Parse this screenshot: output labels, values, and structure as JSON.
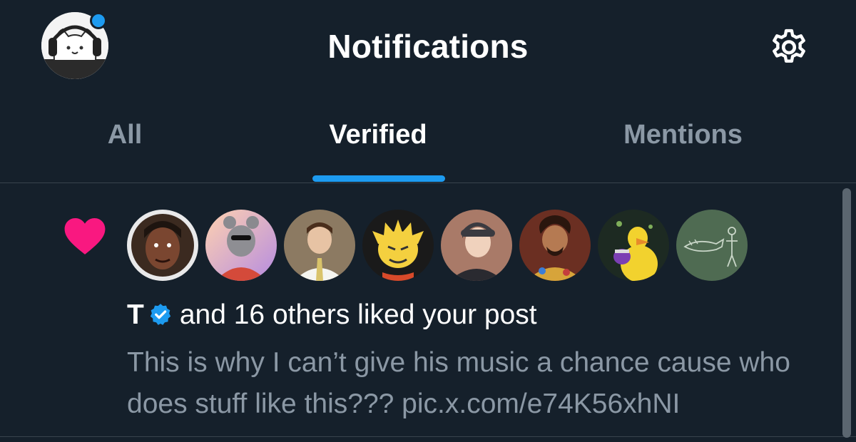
{
  "header": {
    "title": "Notifications"
  },
  "tabs": [
    {
      "label": "All",
      "active": false
    },
    {
      "label": "Verified",
      "active": true
    },
    {
      "label": "Mentions",
      "active": false
    }
  ],
  "notification": {
    "type_icon": "heart-icon",
    "user_name": "T",
    "verified_icon": "verified-badge-icon",
    "action_text": "and 16 others liked your post",
    "post_text": "This is why I can’t give his music a chance cause who does stuff like this??? pic.x.com/e74K56xhNI"
  },
  "colors": {
    "background": "#15202b",
    "accent": "#1d9bf0",
    "like": "#f91880",
    "muted_text": "#8b98a5",
    "divider": "#38444d"
  }
}
